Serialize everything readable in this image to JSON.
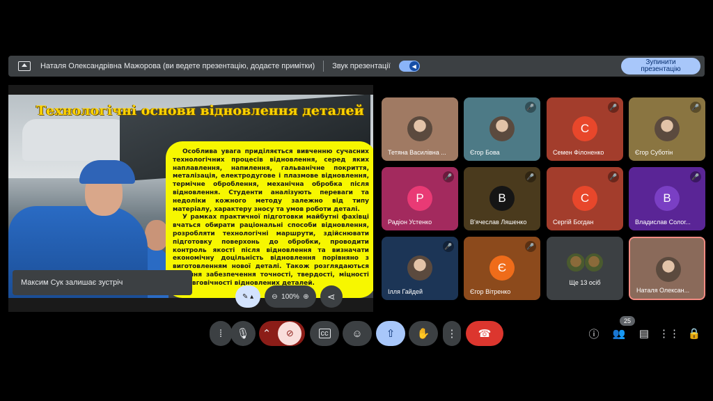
{
  "present_bar": {
    "text": "Наталя Олександрівна Мажорова (ви ведете презентацію, додаєте примітки)",
    "sound_label": "Звук презентації",
    "stop_label": "Зупинити презентацію"
  },
  "slide": {
    "title": "Технологічні основи відновлення деталей",
    "paragraph1": "Особлива увага приділяється вивченню сучасних технологічних процесів відновлення, серед яких наплавлення, напилення, гальванічне покриття, металізація, електродугове і плазмове відновлення, термічне оброблення, механічна обробка після відновлення. Студенти аналізують переваги та недоліки кожного методу залежно від типу матеріалу, характеру зносу та умов роботи деталі.",
    "paragraph2": "У рамках практичної підготовки майбутні фахівці вчаться обирати раціональні способи відновлення, розробляти технологічні маршрути, здійснювати підготовку поверхонь до обробки, проводити контроль якості після відновлення та визначати економічну доцільність відновлення порівняно з виготовленням нової деталі. Також розглядаються питання забезпечення точності, твердості, міцності та довговічності відновлених деталей."
  },
  "toast": "Максим Сук залишає зустріч",
  "zoom": {
    "level": "100%"
  },
  "participants": [
    {
      "name": "Тетяна Василівна ...",
      "type": "photo",
      "bg": "#a07a63",
      "muted": false
    },
    {
      "name": "Єгор Бова",
      "type": "photo",
      "bg": "#4d7a86",
      "muted": true
    },
    {
      "name": "Семен Філоненко",
      "type": "letter",
      "letter": "С",
      "bg": "#a33d2c",
      "avatar": "#e8472b",
      "muted": true
    },
    {
      "name": "Єгор Суботін",
      "type": "photo",
      "bg": "#8a7541",
      "muted": true
    },
    {
      "name": "Радіон Устенко",
      "type": "letter",
      "letter": "Р",
      "bg": "#a32a5e",
      "avatar": "#e93a75",
      "muted": true
    },
    {
      "name": "В'ячеслав Ляшенко",
      "type": "letter",
      "letter": "В",
      "bg": "#4a3a1d",
      "avatar": "#151515",
      "muted": true
    },
    {
      "name": "Сергій Богдан",
      "type": "letter",
      "letter": "С",
      "bg": "#a33d2c",
      "avatar": "#e8472b",
      "muted": true
    },
    {
      "name": "Владислав Солог...",
      "type": "letter",
      "letter": "В",
      "bg": "#5a2596",
      "avatar": "#7a3fc4",
      "muted": true
    },
    {
      "name": "Ілля Гайдей",
      "type": "photo",
      "bg": "#1c3556",
      "muted": true
    },
    {
      "name": "Єгор Вітренко",
      "type": "letter",
      "letter": "Є",
      "bg": "#8c4a1c",
      "avatar": "#ef6c1a",
      "muted": true
    },
    {
      "name": "Ще 13 осіб",
      "type": "group",
      "bg": "#3c4043",
      "muted": false
    },
    {
      "name": "Наталя Олексан...",
      "type": "photo",
      "bg": "#8a6a5a",
      "muted": false
    }
  ],
  "people_count": "25"
}
